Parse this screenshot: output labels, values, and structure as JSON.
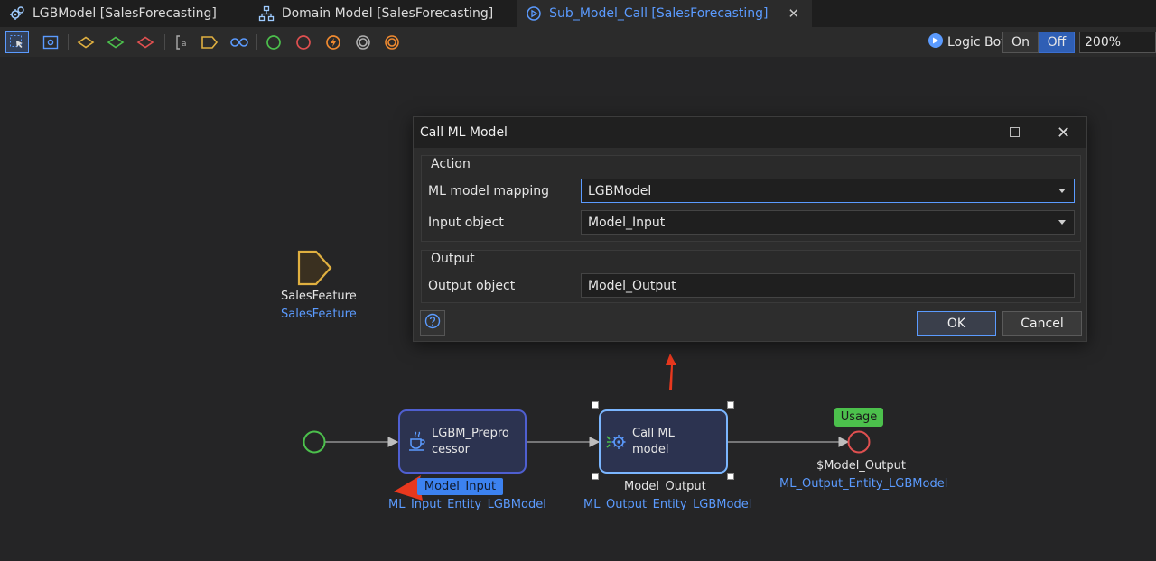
{
  "tabs": [
    {
      "label": "LGBModel [SalesForecasting]",
      "icon": "gears-icon",
      "active": false
    },
    {
      "label": "Domain Model [SalesForecasting]",
      "icon": "hierarchy-icon",
      "active": false
    },
    {
      "label": "Sub_Model_Call [SalesForecasting]",
      "icon": "play-circle-icon",
      "active": true,
      "close": "✕"
    }
  ],
  "toolbar": {
    "logic_bot_label": "Logic Bot",
    "toggle_on": "On",
    "toggle_off": "Off",
    "zoom": "200%",
    "tools": [
      "pointer-icon",
      "screen-icon",
      "decision-icon",
      "merge-icon",
      "error-decision-icon",
      "annotation-icon",
      "parameter-icon",
      "loop-icon",
      "start-event-icon",
      "end-event-icon",
      "error-event-icon",
      "break-event-icon",
      "continue-event-icon"
    ]
  },
  "canvas": {
    "parameter": {
      "name": "SalesFeature",
      "type": "SalesFeature"
    },
    "preprocessor": {
      "line1": "LGBM_Prepro",
      "line2": "cessor",
      "output_badge": "Model_Input",
      "output_type": "ML_Input_Entity_LGBModel"
    },
    "call_ml": {
      "line1": "Call ML",
      "line2": "model",
      "output_name": "Model_Output",
      "output_type": "ML_Output_Entity_LGBModel"
    },
    "end": {
      "badge": "Usage",
      "value": "$Model_Output",
      "type": "ML_Output_Entity_LGBModel"
    }
  },
  "dialog": {
    "title": "Call ML Model",
    "action_group": "Action",
    "ml_model_mapping_label": "ML model mapping",
    "ml_model_mapping_value": "LGBModel",
    "input_object_label": "Input object",
    "input_object_value": "Model_Input",
    "output_group": "Output",
    "output_object_label": "Output object",
    "output_object_value": "Model_Output",
    "ok": "OK",
    "cancel": "Cancel",
    "close": "✕"
  },
  "colors": {
    "accent": "#5b9bff",
    "start_event": "#4cc04c",
    "end_event": "#e05050",
    "annotation_arrow": "#e8381e"
  }
}
